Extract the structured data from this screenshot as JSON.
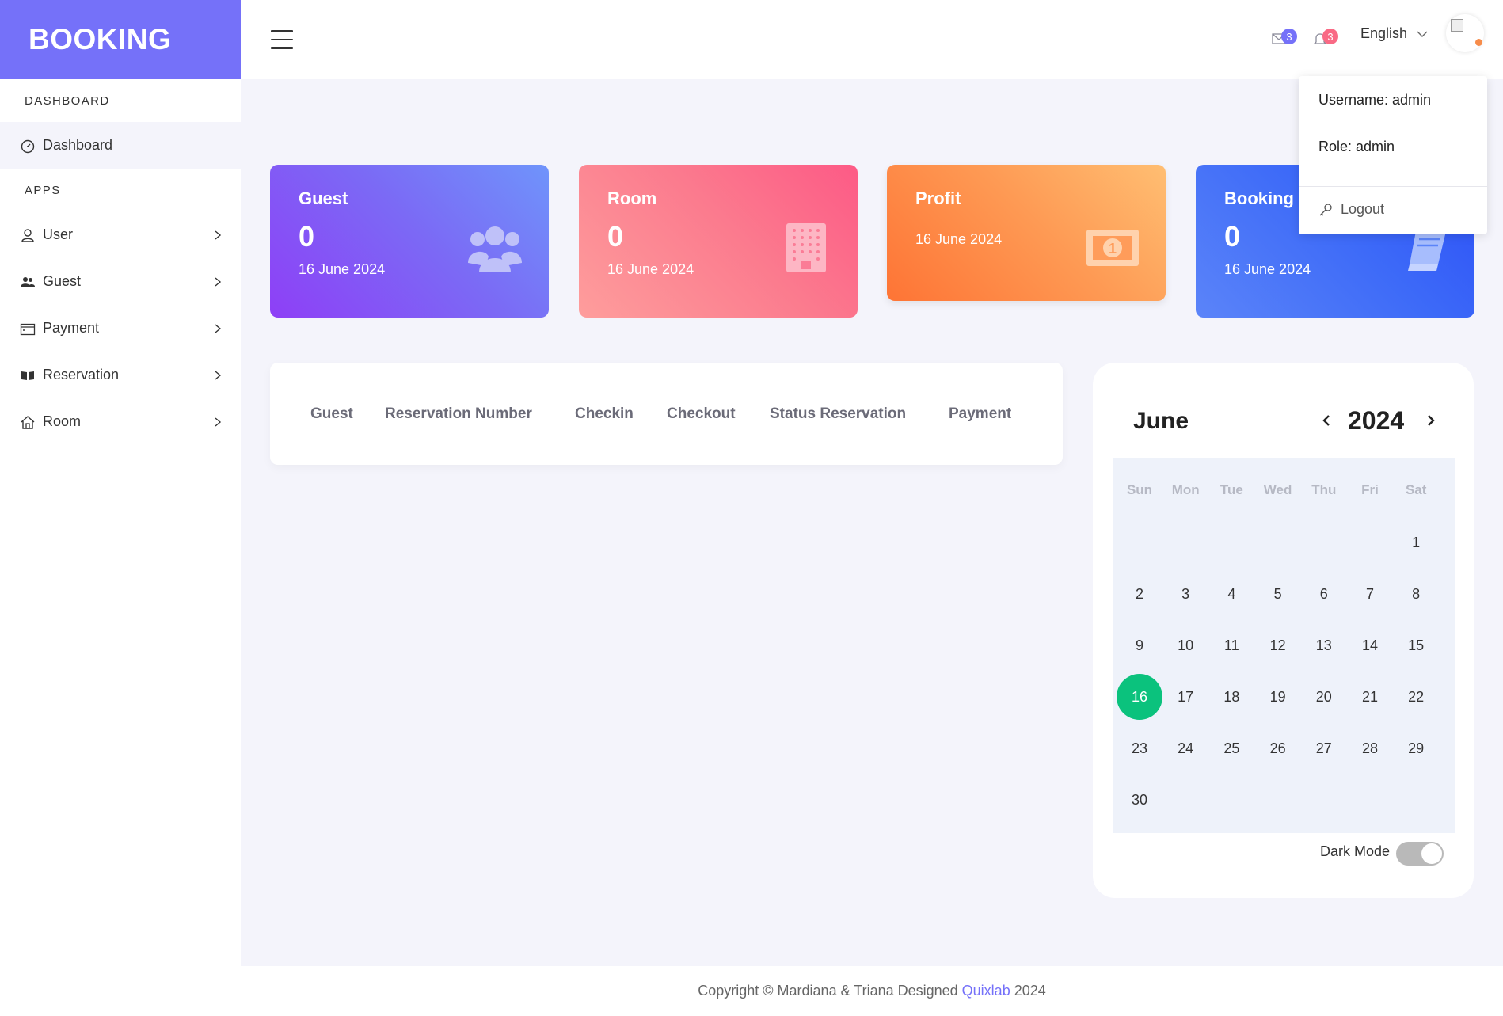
{
  "sidebar": {
    "brand": "BOOKING",
    "section_dashboard": "DASHBOARD",
    "dashboard": "Dashboard",
    "section_apps": "APPS",
    "items": [
      {
        "label": "User",
        "icon": "user-icon"
      },
      {
        "label": "Guest",
        "icon": "users-icon"
      },
      {
        "label": "Payment",
        "icon": "wallet-icon"
      },
      {
        "label": "Reservation",
        "icon": "book-icon"
      },
      {
        "label": "Room",
        "icon": "home-icon"
      }
    ]
  },
  "header": {
    "messages_badge": "3",
    "notifications_badge": "3",
    "language": "English"
  },
  "dropdown": {
    "username": "Username: admin",
    "role": "Role: admin",
    "logout": "Logout"
  },
  "cards": {
    "guest": {
      "title": "Guest",
      "value": "0",
      "date": "16 June 2024"
    },
    "room": {
      "title": "Room",
      "value": "0",
      "date": "16 June 2024"
    },
    "profit": {
      "title": "Profit",
      "date": "16 June 2024"
    },
    "booking": {
      "title": "Booking",
      "value": "0",
      "date": "16 June 2024"
    }
  },
  "table": {
    "headers": [
      "Guest",
      "Reservation Number",
      "Checkin",
      "Checkout",
      "Status Reservation",
      "Payment"
    ]
  },
  "calendar": {
    "month": "June",
    "year": "2024",
    "weekdays": [
      "Sun",
      "Mon",
      "Tue",
      "Wed",
      "Thu",
      "Fri",
      "Sat"
    ],
    "first_weekday": 6,
    "days_in_month": 30,
    "today": 16,
    "dark_mode_label": "Dark Mode",
    "dark_mode_on": true
  },
  "footer": {
    "prefix": "Copyright © Mardiana & Triana Designed",
    "link": "Quixlab",
    "year": "2024"
  },
  "colors": {
    "accent": "#7571f9",
    "today": "#0bc27d",
    "badge_messages": "#7571f9",
    "badge_notifications": "#f96a85"
  }
}
